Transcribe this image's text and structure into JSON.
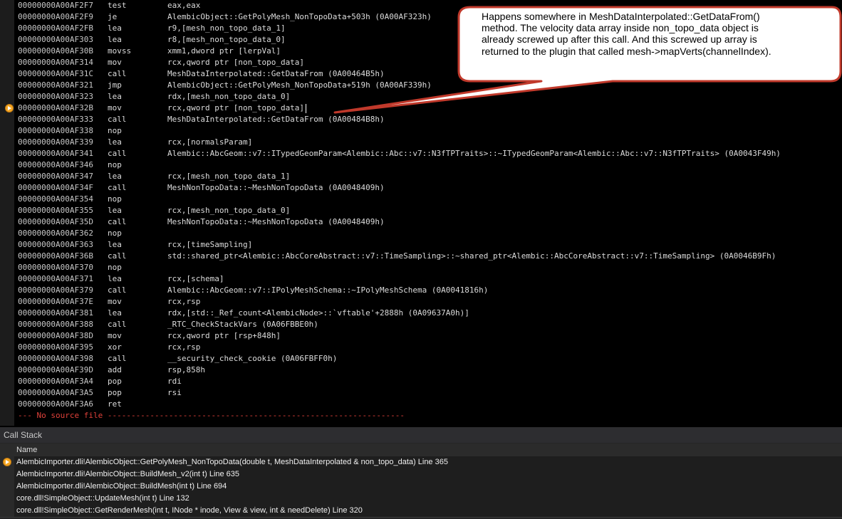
{
  "disassembly": {
    "lines": [
      {
        "address": "00000000A00AF2F7",
        "mnemonic": "test",
        "operands": "eax,eax"
      },
      {
        "address": "00000000A00AF2F9",
        "mnemonic": "je",
        "operands": "AlembicObject::GetPolyMesh_NonTopoData+503h (0A00AF323h)"
      },
      {
        "address": "00000000A00AF2FB",
        "mnemonic": "lea",
        "operands": "r9,[mesh_non_topo_data_1]"
      },
      {
        "address": "00000000A00AF303",
        "mnemonic": "lea",
        "operands": "r8,[mesh_non_topo_data_0]"
      },
      {
        "address": "00000000A00AF30B",
        "mnemonic": "movss",
        "operands": "xmm1,dword ptr [lerpVal]"
      },
      {
        "address": "00000000A00AF314",
        "mnemonic": "mov",
        "operands": "rcx,qword ptr [non_topo_data]"
      },
      {
        "address": "00000000A00AF31C",
        "mnemonic": "call",
        "operands": "MeshDataInterpolated::GetDataFrom (0A00464B5h)"
      },
      {
        "address": "00000000A00AF321",
        "mnemonic": "jmp",
        "operands": "AlembicObject::GetPolyMesh_NonTopoData+519h (0A00AF339h)"
      },
      {
        "address": "00000000A00AF323",
        "mnemonic": "lea",
        "operands": "rdx,[mesh_non_topo_data_0]"
      },
      {
        "address": "00000000A00AF32B",
        "mnemonic": "mov",
        "operands": "rcx,qword ptr [non_topo_data]",
        "current": true
      },
      {
        "address": "00000000A00AF333",
        "mnemonic": "call",
        "operands": "MeshDataInterpolated::GetDataFrom (0A00484B8h)"
      },
      {
        "address": "00000000A00AF338",
        "mnemonic": "nop",
        "operands": ""
      },
      {
        "address": "00000000A00AF339",
        "mnemonic": "lea",
        "operands": "rcx,[normalsParam]"
      },
      {
        "address": "00000000A00AF341",
        "mnemonic": "call",
        "operands": "Alembic::AbcGeom::v7::ITypedGeomParam<Alembic::Abc::v7::N3fTPTraits>::~ITypedGeomParam<Alembic::Abc::v7::N3fTPTraits> (0A0043F49h)"
      },
      {
        "address": "00000000A00AF346",
        "mnemonic": "nop",
        "operands": ""
      },
      {
        "address": "00000000A00AF347",
        "mnemonic": "lea",
        "operands": "rcx,[mesh_non_topo_data_1]"
      },
      {
        "address": "00000000A00AF34F",
        "mnemonic": "call",
        "operands": "MeshNonTopoData::~MeshNonTopoData (0A0048409h)"
      },
      {
        "address": "00000000A00AF354",
        "mnemonic": "nop",
        "operands": ""
      },
      {
        "address": "00000000A00AF355",
        "mnemonic": "lea",
        "operands": "rcx,[mesh_non_topo_data_0]"
      },
      {
        "address": "00000000A00AF35D",
        "mnemonic": "call",
        "operands": "MeshNonTopoData::~MeshNonTopoData (0A0048409h)"
      },
      {
        "address": "00000000A00AF362",
        "mnemonic": "nop",
        "operands": ""
      },
      {
        "address": "00000000A00AF363",
        "mnemonic": "lea",
        "operands": "rcx,[timeSampling]"
      },
      {
        "address": "00000000A00AF36B",
        "mnemonic": "call",
        "operands": "std::shared_ptr<Alembic::AbcCoreAbstract::v7::TimeSampling>::~shared_ptr<Alembic::AbcCoreAbstract::v7::TimeSampling> (0A0046B9Fh)"
      },
      {
        "address": "00000000A00AF370",
        "mnemonic": "nop",
        "operands": ""
      },
      {
        "address": "00000000A00AF371",
        "mnemonic": "lea",
        "operands": "rcx,[schema]"
      },
      {
        "address": "00000000A00AF379",
        "mnemonic": "call",
        "operands": "Alembic::AbcGeom::v7::IPolyMeshSchema::~IPolyMeshSchema (0A0041816h)"
      },
      {
        "address": "00000000A00AF37E",
        "mnemonic": "mov",
        "operands": "rcx,rsp"
      },
      {
        "address": "00000000A00AF381",
        "mnemonic": "lea",
        "operands": "rdx,[std::_Ref_count<AlembicNode>::`vftable'+2888h (0A09637A0h)]"
      },
      {
        "address": "00000000A00AF388",
        "mnemonic": "call",
        "operands": "_RTC_CheckStackVars (0A06FBBE0h)"
      },
      {
        "address": "00000000A00AF38D",
        "mnemonic": "mov",
        "operands": "rcx,qword ptr [rsp+848h]"
      },
      {
        "address": "00000000A00AF395",
        "mnemonic": "xor",
        "operands": "rcx,rsp"
      },
      {
        "address": "00000000A00AF398",
        "mnemonic": "call",
        "operands": "__security_check_cookie (0A06FBFF0h)"
      },
      {
        "address": "00000000A00AF39D",
        "mnemonic": "add",
        "operands": "rsp,858h"
      },
      {
        "address": "00000000A00AF3A4",
        "mnemonic": "pop",
        "operands": "rdi"
      },
      {
        "address": "00000000A00AF3A5",
        "mnemonic": "pop",
        "operands": "rsi"
      },
      {
        "address": "00000000A00AF3A6",
        "mnemonic": "ret",
        "operands": ""
      }
    ],
    "no_source": "--- No source file ---------------------------------------------------------------"
  },
  "callout": {
    "lines": [
      "Happens somewhere in MeshDataInterpolated::GetDataFrom()",
      "method. The velocity data array inside non_topo_data object is",
      "already screwed up after this call. And this screwed up array is",
      "returned to the plugin that called mesh->mapVerts(channelIndex)."
    ]
  },
  "call_stack": {
    "title": "Call Stack",
    "column_header": "Name",
    "frames": [
      {
        "text": "AlembicImporter.dli!AlembicObject::GetPolyMesh_NonTopoData(double t, MeshDataInterpolated & non_topo_data) Line 365",
        "current": true
      },
      {
        "text": "AlembicImporter.dli!AlembicObject::BuildMesh_v2(int t) Line 635"
      },
      {
        "text": "AlembicImporter.dli!AlembicObject::BuildMesh(int t) Line 694"
      },
      {
        "text": "core.dll!SimpleObject::UpdateMesh(int t) Line 132"
      },
      {
        "text": "core.dll!SimpleObject::GetRenderMesh(int t, INode * inode, View & view, int & needDelete) Line 320"
      }
    ]
  },
  "colors": {
    "current_arrow": "#f5a623",
    "no_source_text": "#e0413a",
    "callout_border": "#c0392b"
  },
  "icons": {
    "current_instruction": "yellow-arrow-icon"
  }
}
